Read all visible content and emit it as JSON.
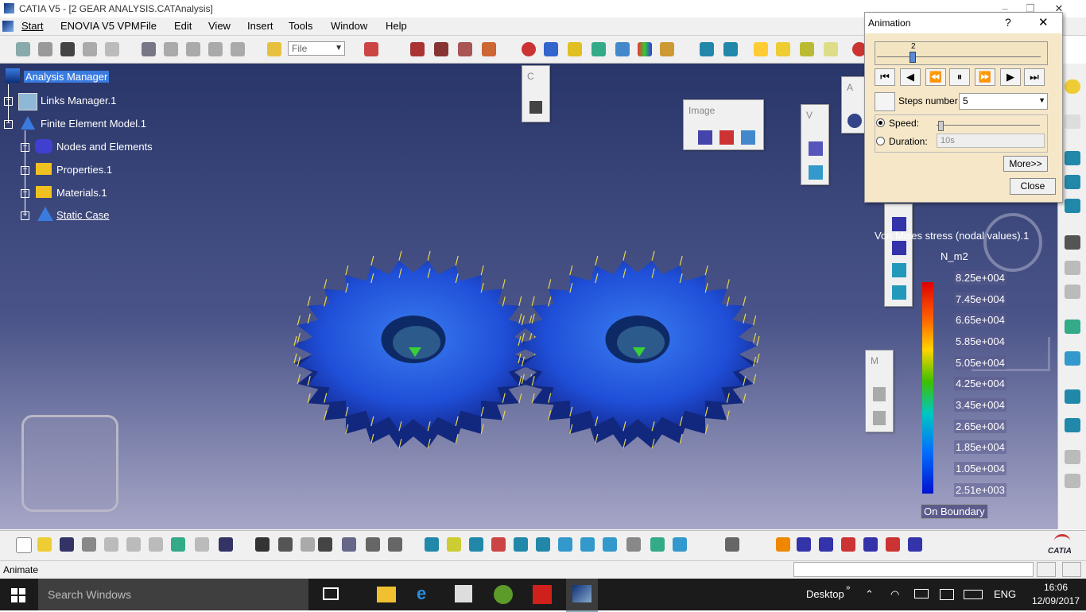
{
  "window": {
    "title": "CATIA V5 - [2 GEAR ANALYSIS.CATAnalysis]",
    "min": "–",
    "max": "❐",
    "close": "✕"
  },
  "menu": [
    "Start",
    "ENOVIA V5 VPM",
    "File",
    "Edit",
    "View",
    "Insert",
    "Tools",
    "Window",
    "Help"
  ],
  "toolbar": {
    "file_combo": "File"
  },
  "tree": {
    "root": "Analysis Manager",
    "links": "Links Manager.1",
    "fem": "Finite Element Model.1",
    "nodes": "Nodes and Elements",
    "properties": "Properties.1",
    "materials": "Materials.1",
    "static": "Static Case"
  },
  "panels": {
    "c": "C",
    "image": "Image",
    "v": "V",
    "a": "A",
    "m": "M"
  },
  "animation": {
    "title": "Animation",
    "help": "?",
    "close_x": "✕",
    "slider_value": "2",
    "slider_position": 0.2,
    "steps_label": "Steps number",
    "steps_value": "5",
    "speed_label": "Speed:",
    "duration_label": "Duration:",
    "duration_value": "10s",
    "mode": "speed",
    "more_button": "More>>",
    "close_button": "Close"
  },
  "legend": {
    "title": "Von Mises stress (nodal values).1",
    "unit": "N_m2",
    "values": [
      "8.25e+004",
      "7.45e+004",
      "6.65e+004",
      "5.85e+004",
      "5.05e+004",
      "4.25e+004",
      "3.45e+004",
      "2.65e+004",
      "1.85e+004",
      "1.05e+004",
      "2.51e+003"
    ],
    "mode": "On Boundary"
  },
  "statusbar": {
    "text": "Animate"
  },
  "taskbar": {
    "search": "Search Windows",
    "desktop": "Desktop",
    "lang": "ENG",
    "time": "16:06",
    "date": "12/09/2017"
  },
  "brand": "CATIA",
  "colors": {
    "viewport_top": "#29366a",
    "gear": "#1a4fd0",
    "selection": "#3a7be0",
    "dialog_bg": "#f5e7c8"
  }
}
